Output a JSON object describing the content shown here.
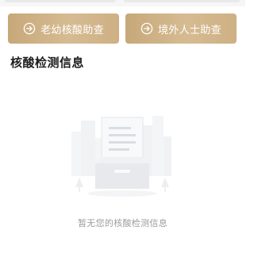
{
  "actions": {
    "elderly_child_check": "老幼核酸助查",
    "overseas_check": "境外人士助查"
  },
  "section": {
    "title": "核酸检测信息"
  },
  "empty_state": {
    "message": "暂无您的核酸检测信息",
    "icon": "empty-document-tray-icon"
  },
  "colors": {
    "button_gradient_start": "#c7a879",
    "button_gradient_end": "#d6bb92",
    "title_text": "#1f1f1f",
    "muted_text": "#9b9b9b"
  }
}
